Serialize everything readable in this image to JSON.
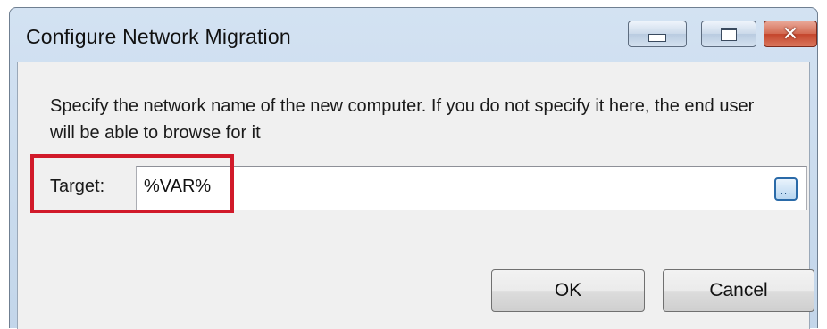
{
  "window": {
    "title": "Configure Network Migration",
    "controls": {
      "minimize_icon": "minimize-icon",
      "maximize_icon": "maximize-icon",
      "close_icon": "close-icon",
      "close_glyph": "✕"
    }
  },
  "dialog": {
    "instruction": "Specify the network name of the new computer. If you do not specify it here, the end user will be able to browse for it",
    "target": {
      "label": "Target:",
      "value": "%VAR%",
      "browse_icon": "browse-icon",
      "browse_glyph": "..."
    },
    "buttons": {
      "ok": "OK",
      "cancel": "Cancel"
    }
  },
  "annotation": {
    "highlight_color": "#d11a2a"
  }
}
